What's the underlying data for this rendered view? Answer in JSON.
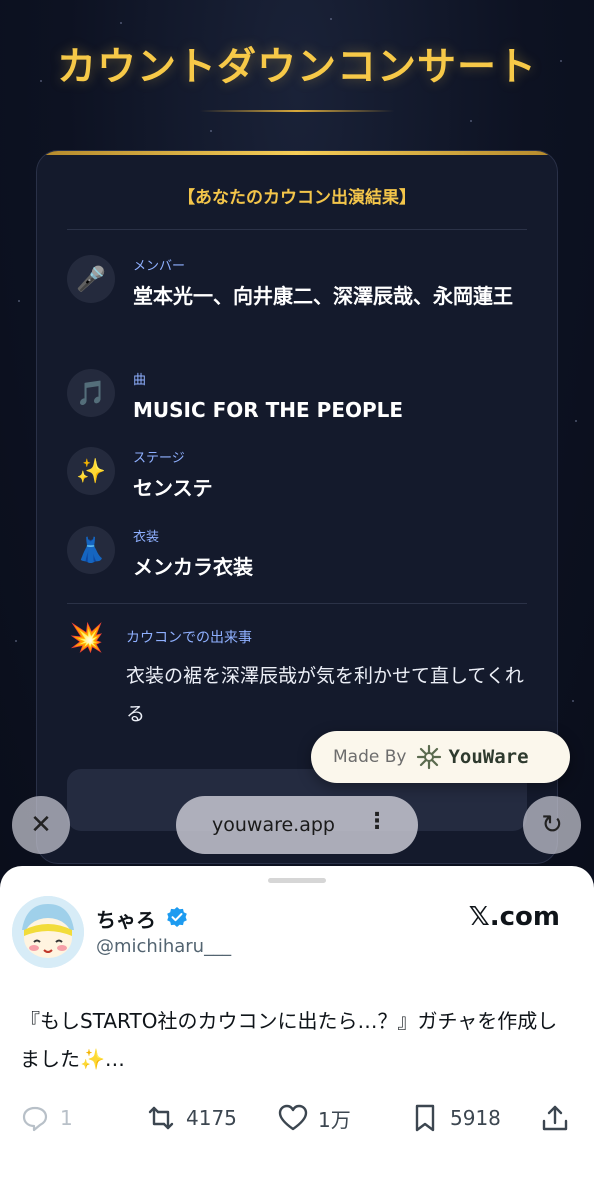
{
  "hero": {
    "title": "カウントダウンコンサート"
  },
  "card": {
    "heading": "【あなたのカウコン出演結果】",
    "rows": [
      {
        "icon": "microphone-icon",
        "emoji": "🎤",
        "label": "メンバー",
        "value": "堂本光一、向井康二、深澤辰哉、永岡蓮王"
      },
      {
        "icon": "music-note-icon",
        "emoji": "🎵",
        "label": "曲",
        "value": "MUSIC FOR THE PEOPLE"
      },
      {
        "icon": "sparkles-icon",
        "emoji": "✨",
        "label": "ステージ",
        "value": "センステ"
      },
      {
        "icon": "dress-icon",
        "emoji": "👗",
        "label": "衣装",
        "value": "メンカラ衣装"
      }
    ],
    "event": {
      "icon": "collision-icon",
      "emoji": "💥",
      "label": "カウコンでの出来事",
      "text": "衣装の裾を深澤辰哉が気を利かせて直してくれる"
    }
  },
  "made_by": {
    "label": "Made By",
    "brand": "YouWare"
  },
  "browser": {
    "url": "youware.app",
    "menu_glyph": "⋮",
    "close_glyph": "✕",
    "reload_glyph": "↻"
  },
  "tweet": {
    "author_name": "ちゃろ",
    "handle": "@michiharu___",
    "site": "𝕏.com",
    "text": "『もしSTARTO社のカウコンに出たら…？』ガチャを作成しました✨…",
    "replies": "1",
    "retweets": "4175",
    "likes": "1万",
    "bookmarks": "5918"
  },
  "colors": {
    "gold": "#f7c948",
    "label_blue": "#8fb0ff",
    "card_bg": "#141a2c",
    "verified_blue": "#1d9bf0"
  }
}
